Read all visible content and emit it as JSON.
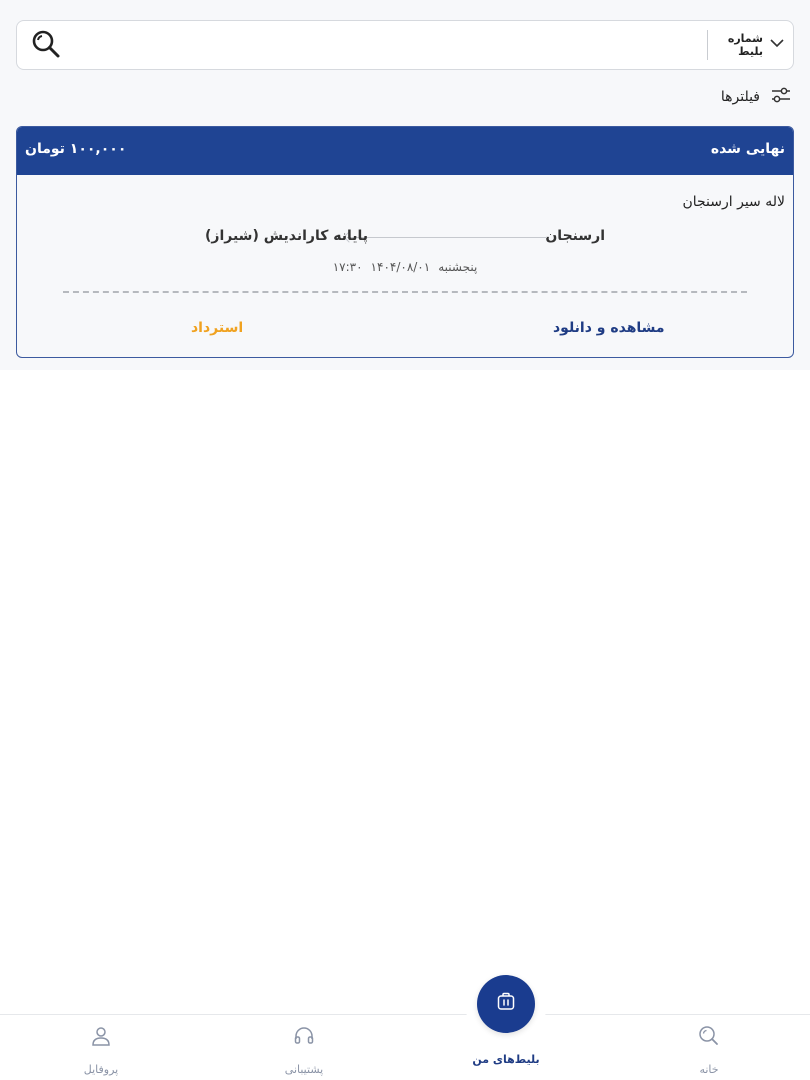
{
  "search": {
    "type_label": "شماره بلیط",
    "placeholder": ""
  },
  "filters": {
    "label": "فیلترها"
  },
  "ticket": {
    "status": "نهایی شده",
    "price": "۱۰۰,۰۰۰ تومان",
    "company": "لاله سیر ارسنجان",
    "origin": "ارسنجان",
    "destination": "پایانه کاراندیش (شیراز)",
    "day": "پنجشنبه",
    "date": "۱۴۰۴/۰۸/۰۱",
    "time": "۱۷:۳۰",
    "view_download_label": "مشاهده و دانلود",
    "refund_label": "استرداد"
  },
  "nav": {
    "home": "خانه",
    "my_tickets": "بلیط‌های من",
    "support": "پشتیبانی",
    "profile": "پروفایل"
  },
  "colors": {
    "primary": "#1f4493",
    "accent_orange": "#f0a220",
    "nav_inactive": "#8a93a6"
  }
}
